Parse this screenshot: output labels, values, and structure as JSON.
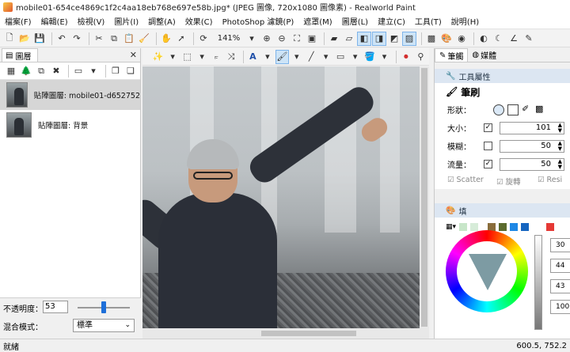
{
  "window": {
    "title": "mobile01-654ce4869c1f2c4aa18eb768e697e58b.jpg* (JPEG 圖像, 720x1080 圖像素) - Realworld Paint"
  },
  "menu": [
    "檔案(F)",
    "編輯(E)",
    "檢視(V)",
    "圖片(I)",
    "調整(A)",
    "效果(C)",
    "PhotoShop 濾鏡(P)",
    "遮罩(M)",
    "圖層(L)",
    "建立(C)",
    "工具(T)",
    "說明(H)"
  ],
  "toolbar": {
    "zoom": "141%"
  },
  "layers_panel": {
    "tab": "圖層",
    "layers": [
      {
        "name": "貼陣圖層: mobile01-d652752",
        "active": true
      },
      {
        "name": "貼陣圖層: 背景",
        "active": false
      }
    ],
    "opacity_label": "不透明度：",
    "opacity_value": "53",
    "opacity_fraction": 0.53,
    "blend_label": "混合模式：",
    "blend_value": "標準"
  },
  "right_panel": {
    "tabs": [
      {
        "label": "筆觸"
      },
      {
        "label": "媒體"
      }
    ],
    "tool_props_header": "工具屬性",
    "brush_title": "筆刷",
    "shape_label": "形狀：",
    "rows": [
      {
        "label": "大小：",
        "checked": true,
        "value": "101"
      },
      {
        "label": "模糊：",
        "checked": false,
        "value": "50"
      },
      {
        "label": "流量：",
        "checked": true,
        "value": "50"
      }
    ],
    "options": [
      "Scatter",
      "旋轉",
      "Resi"
    ],
    "color_header": "填",
    "color_values": [
      "30",
      "44",
      "43",
      "100"
    ],
    "palette_colors": [
      "#c8e6c9",
      "#d7ecd9",
      "#8a6d3b",
      "#5b6b2e",
      "#1e88e5",
      "#1565c0",
      "#e53935"
    ]
  },
  "status": {
    "left": "就緒",
    "right": "600.5, 752.2"
  }
}
